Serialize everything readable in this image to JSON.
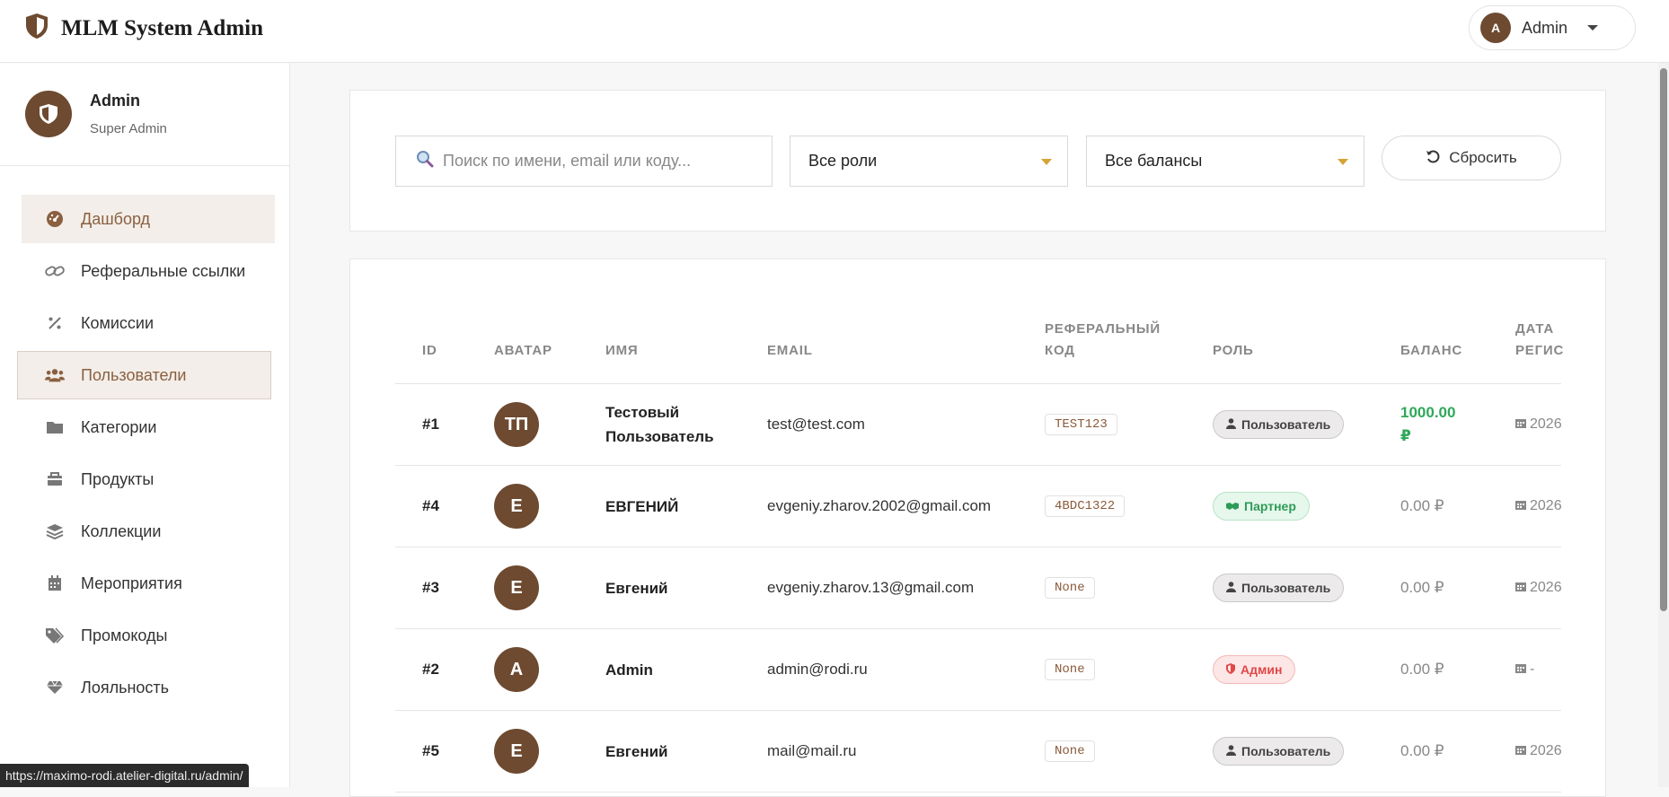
{
  "header": {
    "title": "MLM System Admin",
    "user_initial": "A",
    "user_name": "Admin"
  },
  "sidebar": {
    "profile": {
      "name": "Admin",
      "role": "Super Admin"
    },
    "items": [
      {
        "label": "Дашборд",
        "icon": "dashboard-icon"
      },
      {
        "label": "Реферальные ссылки",
        "icon": "link-icon"
      },
      {
        "label": "Комиссии",
        "icon": "percent-icon"
      },
      {
        "label": "Пользователи",
        "icon": "users-icon"
      },
      {
        "label": "Категории",
        "icon": "folder-icon"
      },
      {
        "label": "Продукты",
        "icon": "box-icon"
      },
      {
        "label": "Коллекции",
        "icon": "layers-icon"
      },
      {
        "label": "Мероприятия",
        "icon": "calendar-icon"
      },
      {
        "label": "Промокоды",
        "icon": "tags-icon"
      },
      {
        "label": "Лояльность",
        "icon": "gem-icon"
      }
    ]
  },
  "filters": {
    "search_placeholder": "Поиск по имени, email или коду...",
    "role_select": "Все роли",
    "balance_select": "Все балансы",
    "reset_label": "Сбросить"
  },
  "table": {
    "headers": {
      "id": "ID",
      "avatar": "АВАТАР",
      "name": "ИМЯ",
      "email": "EMAIL",
      "ref_code_1": "РЕФЕРАЛЬНЫЙ",
      "ref_code_2": "КОД",
      "role": "РОЛЬ",
      "balance": "БАЛАНС",
      "date_1": "ДАТА",
      "date_2": "РЕГИС"
    },
    "rows": [
      {
        "id": "#1",
        "initials": "ТП",
        "name_1": "Тестовый",
        "name_2": "Пользователь",
        "email": "test@test.com",
        "code": "TEST123",
        "role": "Пользователь",
        "role_type": "user",
        "balance_1": "1000.00",
        "balance_2": "₽",
        "date": "2026"
      },
      {
        "id": "#4",
        "initials": "Е",
        "name_1": "ЕВГЕНИЙ",
        "name_2": "",
        "email": "evgeniy.zharov.2002@gmail.com",
        "code": "4BDC1322",
        "role": "Партнер",
        "role_type": "partner",
        "balance_1": "0.00 ₽",
        "balance_2": "",
        "date": "2026"
      },
      {
        "id": "#3",
        "initials": "Е",
        "name_1": "Евгений",
        "name_2": "",
        "email": "evgeniy.zharov.13@gmail.com",
        "code": "None",
        "role": "Пользователь",
        "role_type": "user",
        "balance_1": "0.00 ₽",
        "balance_2": "",
        "date": "2026"
      },
      {
        "id": "#2",
        "initials": "A",
        "name_1": "Admin",
        "name_2": "",
        "email": "admin@rodi.ru",
        "code": "None",
        "role": "Админ",
        "role_type": "admin",
        "balance_1": "0.00 ₽",
        "balance_2": "",
        "date": "-"
      },
      {
        "id": "#5",
        "initials": "Е",
        "name_1": "Евгений",
        "name_2": "",
        "email": "mail@mail.ru",
        "code": "None",
        "role": "Пользователь",
        "role_type": "user",
        "balance_1": "0.00 ₽",
        "balance_2": "",
        "date": "2026"
      }
    ]
  },
  "statusbar": {
    "url": "https://maximo-rodi.atelier-digital.ru/admin/"
  },
  "colors": {
    "brand": "#6d4a30",
    "accent_bg": "#f3eee9",
    "caret": "#d4a434",
    "positive": "#2fa85a"
  }
}
